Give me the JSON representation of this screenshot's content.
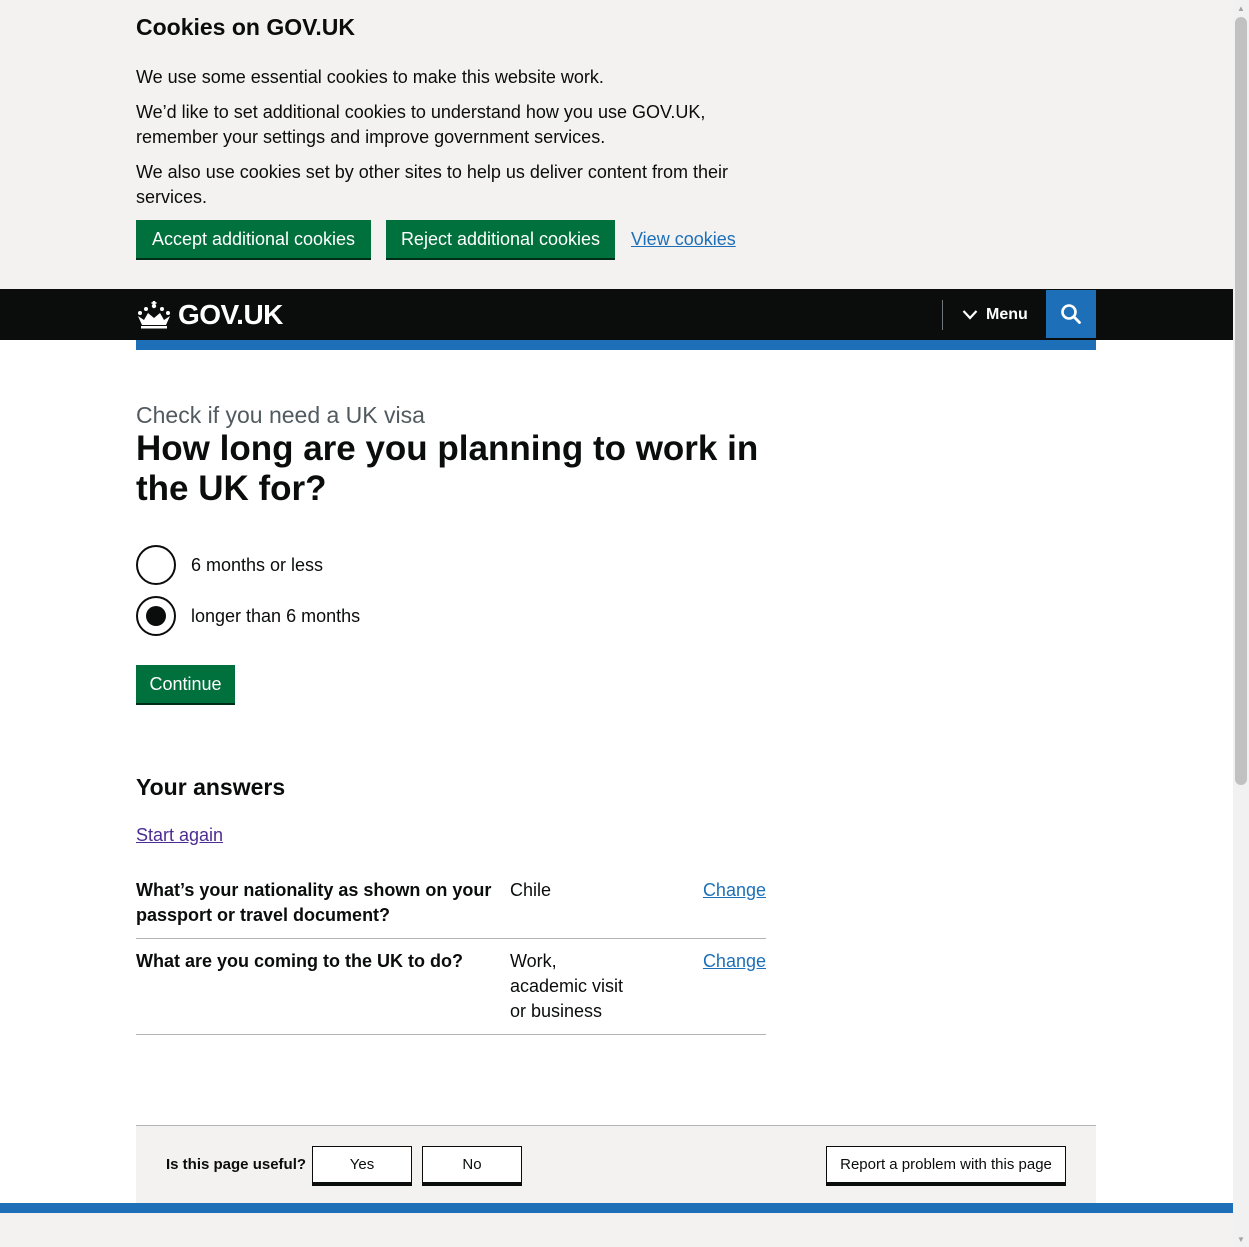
{
  "cookie_banner": {
    "title": "Cookies on GOV.UK",
    "paragraph_1": "We use some essential cookies to make this website work.",
    "paragraph_2": "We’d like to set additional cookies to understand how you use GOV.UK, remember your settings and improve government services.",
    "paragraph_3": "We also use cookies set by other sites to help us deliver content from their services.",
    "accept_label": "Accept additional cookies",
    "reject_label": "Reject additional cookies",
    "view_label": "View cookies"
  },
  "header": {
    "logo_text": "GOV.UK",
    "menu_label": "Menu",
    "search_icon": "search-icon"
  },
  "main": {
    "caption": "Check if you need a UK visa",
    "heading": "How long are you planning to work in the UK for?",
    "options": [
      {
        "label": "6 months or less",
        "selected": false
      },
      {
        "label": "longer than 6 months",
        "selected": true
      }
    ],
    "continue_label": "Continue"
  },
  "answers": {
    "title": "Your answers",
    "start_again": "Start again",
    "rows": [
      {
        "question": "What’s your nationality as shown on your passport or travel document?",
        "answer": "Chile",
        "change": "Change"
      },
      {
        "question": "What are you coming to the UK to do?",
        "answer": "Work, academic visit or business",
        "change": "Change"
      }
    ]
  },
  "feedback": {
    "question": "Is this page useful?",
    "yes_label": "Yes",
    "no_label": "No",
    "report_label": "Report a problem with this page"
  },
  "colors": {
    "button_green": "#00703c",
    "link_blue": "#1d70b8",
    "header_black": "#0b0c0c",
    "banner_grey": "#f3f2f1"
  }
}
